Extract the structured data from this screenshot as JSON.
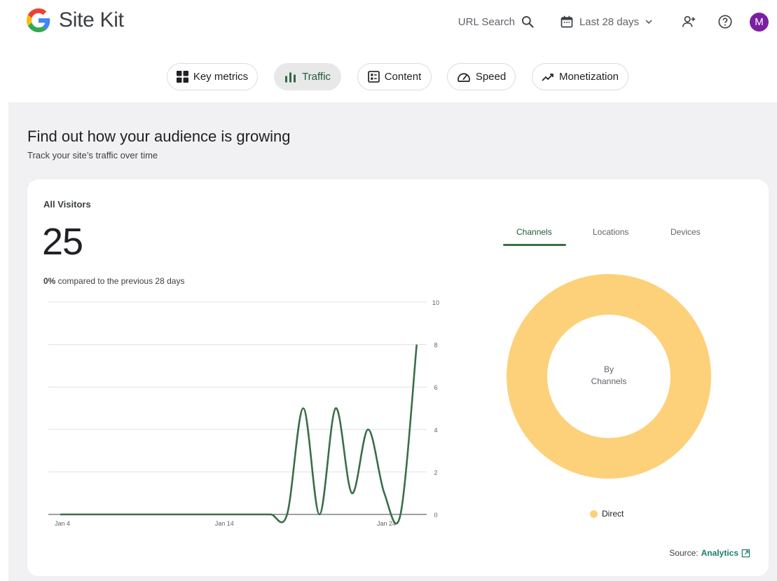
{
  "header": {
    "brand": "Site Kit",
    "url_search_label": "URL Search",
    "date_range_label": "Last 28 days",
    "avatar_initial": "M"
  },
  "tabs": [
    {
      "label": "Key metrics",
      "icon": "grid-icon",
      "active": false
    },
    {
      "label": "Traffic",
      "icon": "bar-chart-icon",
      "active": true
    },
    {
      "label": "Content",
      "icon": "document-icon",
      "active": false
    },
    {
      "label": "Speed",
      "icon": "speedometer-icon",
      "active": false
    },
    {
      "label": "Monetization",
      "icon": "trending-up-icon",
      "active": false
    }
  ],
  "section": {
    "title": "Find out how your audience is growing",
    "subtitle": "Track your site’s traffic over time"
  },
  "card": {
    "label": "All Visitors",
    "total": "25",
    "compare_value": "0%",
    "compare_text": " compared to the previous 28 days",
    "channel_tabs": [
      "Channels",
      "Locations",
      "Devices"
    ],
    "active_channel_tab": "Channels",
    "donut_center_line1": "By",
    "donut_center_line2": "Channels",
    "source_label": "Source:",
    "source_link": "Analytics"
  },
  "colors": {
    "accent_green": "#3a6e48",
    "donut": "#fdd17a",
    "avatar": "#7b1fa2",
    "link": "#1a7d6b"
  },
  "chart_data": [
    {
      "type": "line",
      "x_tick_labels": [
        "Jan 4",
        "Jan 14",
        "Jan 24"
      ],
      "y_ticks": [
        0,
        2,
        4,
        6,
        8,
        10
      ],
      "ylim": [
        0,
        10
      ],
      "grid": true,
      "series": [
        {
          "values": [
            0,
            0,
            0,
            0,
            0,
            0,
            0,
            0,
            0,
            0,
            0,
            0,
            0,
            0,
            0,
            5,
            0,
            5,
            1,
            4,
            1,
            0,
            8
          ]
        }
      ],
      "x_points": [
        "Jan 4",
        "Jan 5",
        "Jan 6",
        "Jan 7",
        "Jan 8",
        "Jan 9",
        "Jan 10",
        "Jan 11",
        "Jan 12",
        "Jan 13",
        "Jan 14",
        "Jan 15",
        "Jan 16",
        "Jan 17",
        "Jan 18",
        "Jan 19",
        "Jan 20",
        "Jan 21",
        "Jan 22",
        "Jan 23",
        "Jan 24",
        "Jan 25",
        "Jan 26"
      ]
    },
    {
      "type": "pie",
      "categories": [
        "Direct"
      ],
      "values": [
        25
      ],
      "legend_position": "bottom"
    }
  ]
}
